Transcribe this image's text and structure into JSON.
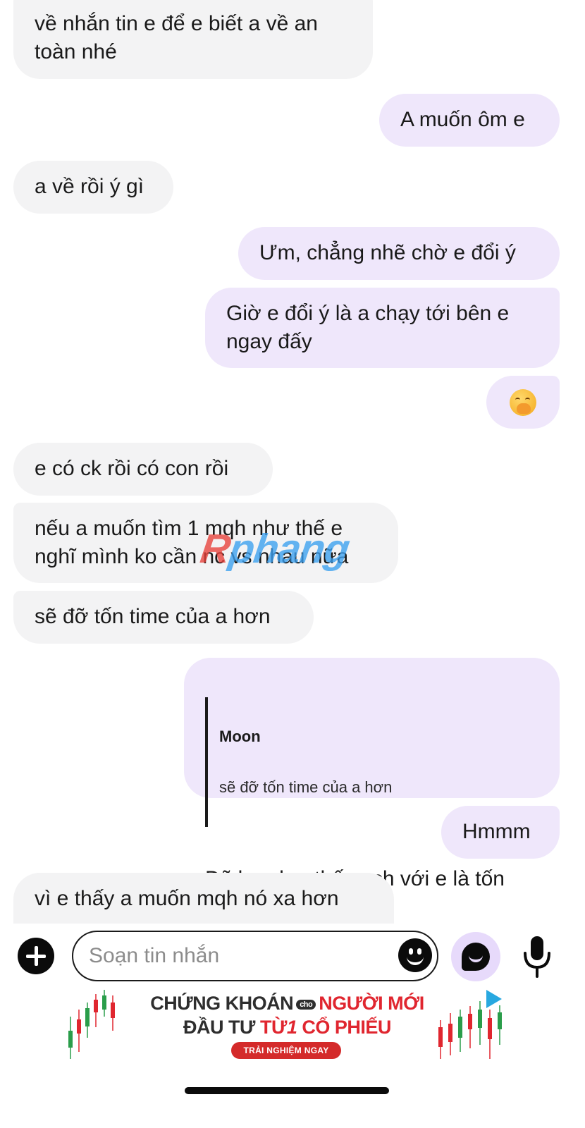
{
  "messages": [
    {
      "direction": "incoming",
      "text": "về nhắn tin e để e biết a về an\ntoàn nhé"
    },
    {
      "direction": "outgoing",
      "text": "A muốn ôm e"
    },
    {
      "direction": "incoming",
      "text": "a về rồi ý gì"
    },
    {
      "direction": "outgoing",
      "text": "Ưm, chẳng nhẽ chờ e đổi ý"
    },
    {
      "direction": "outgoing",
      "text": "Giờ e đổi ý là a chạy tới bên e\nngay đấy"
    },
    {
      "direction": "outgoing",
      "emoji": "face-with-hand-over-mouth"
    },
    {
      "direction": "incoming",
      "text": "e có ck rồi có con rồi"
    },
    {
      "direction": "incoming",
      "text": "nếu a muốn tìm 1 mqh như thế e\nnghĩ mình ko cần nc vs nhau nữa"
    },
    {
      "direction": "incoming",
      "text": "sẽ đỡ tốn time của a hơn"
    },
    {
      "direction": "outgoing",
      "reply_to": {
        "author": "Moon",
        "text": "sẽ đỡ tốn time của a hơn"
      },
      "text": "Đã bao h a thấy nch với e là tốn\nthời gian đâu"
    },
    {
      "direction": "outgoing",
      "text": "Hmmm"
    },
    {
      "direction": "incoming",
      "text": "vì e thấy a muốn mqh nó xa hơn"
    }
  ],
  "watermark": {
    "prefix": "R",
    "rest": "phang"
  },
  "composer": {
    "placeholder": "Soạn tin nhắn",
    "icons": [
      "plus-icon",
      "sticker-icon",
      "ai-assistant-icon",
      "microphone-icon"
    ]
  },
  "ad": {
    "line1_part1": "CHỨNG KHOÁN",
    "line1_badge": "cho",
    "line1_part2": "NGƯỜI MỚI",
    "line2_part1": "ĐẦU TƯ",
    "line2_part2": "TỪ",
    "line2_number": "1",
    "line2_part3": "CỔ PHIẾU",
    "cta": "TRẢI NGHIỆM NGAY"
  },
  "colors": {
    "incoming_bubble": "#f3f3f4",
    "outgoing_bubble": "#efe7fb",
    "accent_red": "#e0262f",
    "ai_button_bg": "#e7dafb"
  }
}
